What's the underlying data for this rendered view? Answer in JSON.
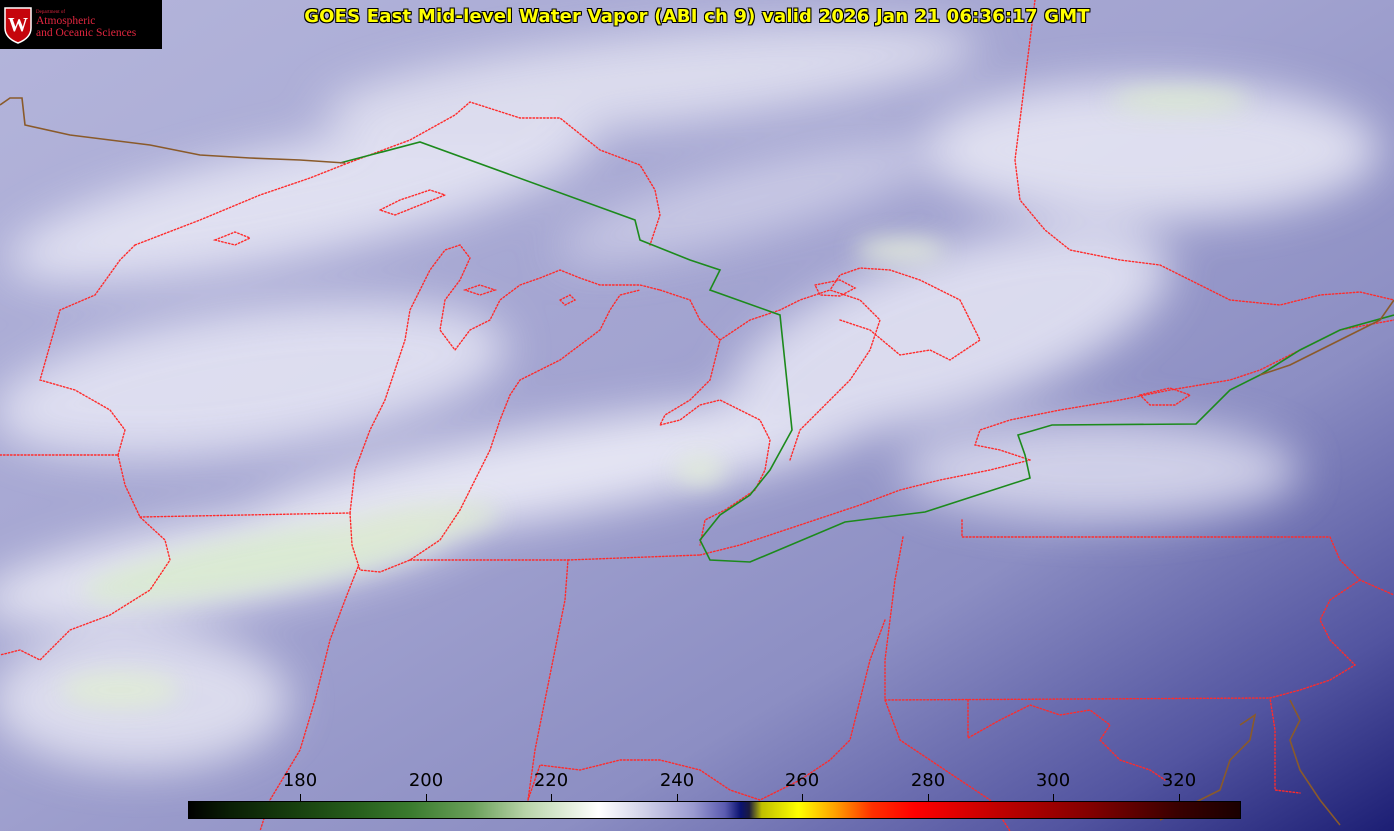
{
  "title": "GOES East Mid-level Water Vapor (ABI ch 9)  valid 2026 Jan 21 06:36:17 GMT",
  "logo": {
    "department": "Department of",
    "line1": "Atmospheric",
    "line2": "and Oceanic Sciences",
    "crest_letter": "W"
  },
  "colorbar": {
    "unit_range": [
      162,
      330
    ],
    "ticks": [
      "180",
      "200",
      "220",
      "240",
      "260",
      "280",
      "300",
      "320"
    ]
  },
  "colors": {
    "background": "#000000",
    "title": "#ffff00",
    "logo_text": "#e0263f",
    "state_borders": "#ff2020",
    "international_border": "#1a8a1a",
    "coastline": "#8a5a2a"
  }
}
